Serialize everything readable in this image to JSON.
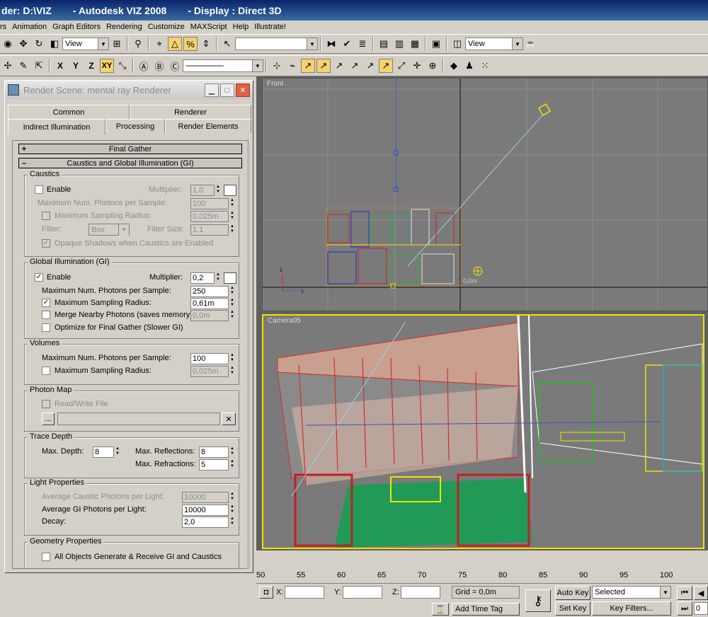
{
  "title": {
    "path": "der: D:\\VIZ",
    "app": "- Autodesk VIZ 2008",
    "display": "- Display : Direct 3D"
  },
  "menu": [
    "rs",
    "Animation",
    "Graph Editors",
    "Rendering",
    "Customize",
    "MAXScript",
    "Help",
    "Illustrate!"
  ],
  "toolbar": {
    "view_combo": "View",
    "view_combo2": "View",
    "selection_set": "",
    "axis_active": "XY",
    "axis_x": "X",
    "axis_y": "Y",
    "axis_z": "Z"
  },
  "viewports": {
    "front_label": "Front",
    "camera_label": "Camera05",
    "front_coord": "0,0m"
  },
  "dialog": {
    "title": "Render Scene: mental ray Renderer",
    "tabs_row1": [
      "Common",
      "Renderer"
    ],
    "tabs_row2": [
      "Indirect Illumination",
      "Processing",
      "Render Elements"
    ],
    "rollout_final_gather": "Final Gather",
    "rollout_caustics_gi": "Caustics and Global Illumination (GI)",
    "caustics": {
      "title": "Caustics",
      "enable": "Enable",
      "multiplier_label": "Multiplier:",
      "multiplier": "1,0",
      "max_photons_label": "Maximum Num. Photons per Sample:",
      "max_photons": "100",
      "max_radius_label": "Maximum Sampling Radius:",
      "max_radius": "0,025m",
      "filter_label": "Filter:",
      "filter": "Box",
      "filter_size_label": "Filter Size:",
      "filter_size": "1,1",
      "opaque_label": "Opaque Shadows when Caustics are Enabled"
    },
    "gi": {
      "title": "Global Illumination (GI)",
      "enable": "Enable",
      "multiplier_label": "Multiplier:",
      "multiplier": "0,2",
      "max_photons_label": "Maximum Num. Photons per Sample:",
      "max_photons": "250",
      "max_radius_label": "Maximum Sampling Radius:",
      "max_radius": "0,61m",
      "merge_label": "Merge Nearby Photons (saves memory):",
      "merge": "0,0m",
      "optimize_label": "Optimize for Final Gather (Slower GI)"
    },
    "volumes": {
      "title": "Volumes",
      "max_photons_label": "Maximum Num. Photons per Sample:",
      "max_photons": "100",
      "max_radius_label": "Maximum Sampling Radius:",
      "max_radius": "0,025m"
    },
    "photon_map": {
      "title": "Photon Map",
      "rw_label": "Read/Write File",
      "browse": "...",
      "path": ""
    },
    "trace_depth": {
      "title": "Trace Depth",
      "max_depth_label": "Max. Depth:",
      "max_depth": "8",
      "max_reflections_label": "Max. Reflections:",
      "max_reflections": "8",
      "max_refractions_label": "Max. Refractions:",
      "max_refractions": "5"
    },
    "light_props": {
      "title": "Light Properties",
      "avg_caustic_label": "Average Caustic Photons per Light:",
      "avg_caustic": "10000",
      "avg_gi_label": "Average GI Photons per Light:",
      "avg_gi": "10000",
      "decay_label": "Decay:",
      "decay": "2,0"
    },
    "geometry_props": {
      "title": "Geometry Properties",
      "all_objects_label": "All Objects Generate & Receive GI and Caustics"
    }
  },
  "timeline": {
    "ticks": [
      "50",
      "55",
      "60",
      "65",
      "70",
      "75",
      "80",
      "85",
      "90",
      "95",
      "100"
    ]
  },
  "status": {
    "x_label": "X:",
    "y_label": "Y:",
    "z_label": "Z:",
    "grid": "Grid = 0,0m",
    "add_time_tag": "Add Time Tag",
    "auto_key": "Auto Key",
    "set_key": "Set Key",
    "selected": "Selected",
    "key_filters": "Key Filters...",
    "frame": "0"
  },
  "colors": {
    "active_viewport_border": "#f4e000",
    "viewport_bg": "#7a7a7a"
  }
}
